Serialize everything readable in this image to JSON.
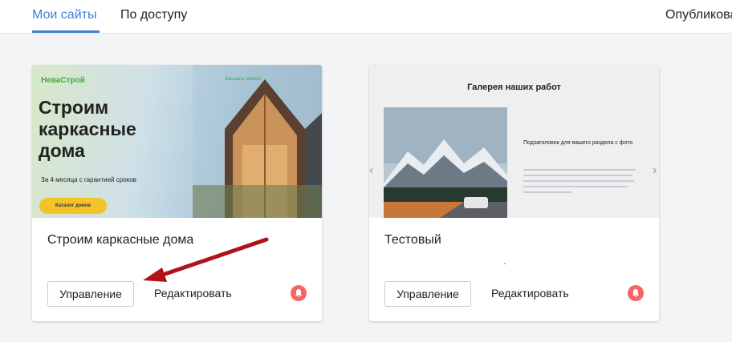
{
  "tabs": {
    "my_sites": "Мои сайты",
    "by_access": "По доступу",
    "published": "Опубликова"
  },
  "cards": [
    {
      "title": "Строим каркасные дома",
      "manage": "Управление",
      "edit": "Редактировать",
      "preview": {
        "brand": "НеваСтрой",
        "link": "Заказать звонок",
        "headline_1": "Строим",
        "headline_2": "каркасные",
        "headline_3": "дома",
        "subtitle": "За 4 месяца с гарантией сроков",
        "cta": "Каталог домов"
      }
    },
    {
      "title": "Тестовый",
      "manage": "Управление",
      "edit": "Редактировать",
      "preview": {
        "heading": "Галерея наших работ",
        "subheading": "Подзаголовок для вашего раздела с фото",
        "prev": "‹",
        "next": "›"
      }
    }
  ],
  "icons": {
    "bell": "bell-icon",
    "arrow": "annotation-arrow"
  },
  "colors": {
    "accent": "#3f7fd8",
    "bell": "#f56565",
    "arrow": "#b01219",
    "cta": "#f2c427",
    "brand": "#3fae3f"
  }
}
